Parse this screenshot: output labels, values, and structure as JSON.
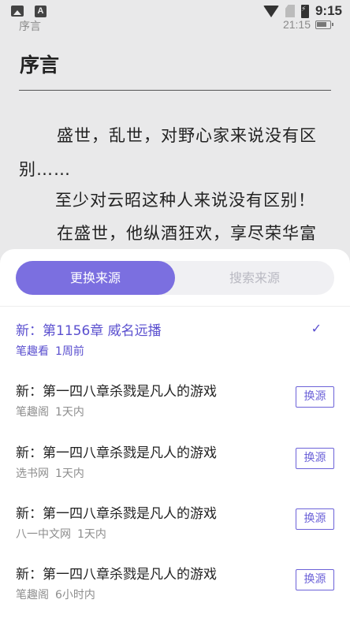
{
  "status_bar": {
    "clock": "9:15"
  },
  "reader": {
    "breadcrumb": "序言",
    "time": "21:15",
    "chapter_title": "序言",
    "paragraphs": [
      "盛世，乱世，对野心家来说没有区",
      "别……",
      "至少对云昭这种人来说没有区别！",
      "在盛世，他纵酒狂欢，享尽荣华富"
    ]
  },
  "sheet": {
    "tabs": [
      {
        "label": "更换来源",
        "active": true
      },
      {
        "label": "搜索来源",
        "active": false
      }
    ],
    "sources": [
      {
        "chapter": "新：第1156章 威名远播",
        "site": "笔趣看",
        "time": "1周前",
        "current": true,
        "check": "✓"
      },
      {
        "chapter": "新：第一四八章杀戮是凡人的游戏",
        "site": "笔趣阁",
        "time": "1天内",
        "button": "换源"
      },
      {
        "chapter": "新：第一四八章杀戮是凡人的游戏",
        "site": "选书网",
        "time": "1天内",
        "button": "换源"
      },
      {
        "chapter": "新：第一四八章杀戮是凡人的游戏",
        "site": "八一中文网",
        "time": "1天内",
        "button": "换源"
      },
      {
        "chapter": "新：第一四八章杀戮是凡人的游戏",
        "site": "笔趣阁",
        "time": "6小时内",
        "button": "换源"
      }
    ]
  },
  "colors": {
    "accent": "#7b6fe0",
    "accent_text": "#5a4fcf",
    "page_bg": "#e9e9ea"
  }
}
